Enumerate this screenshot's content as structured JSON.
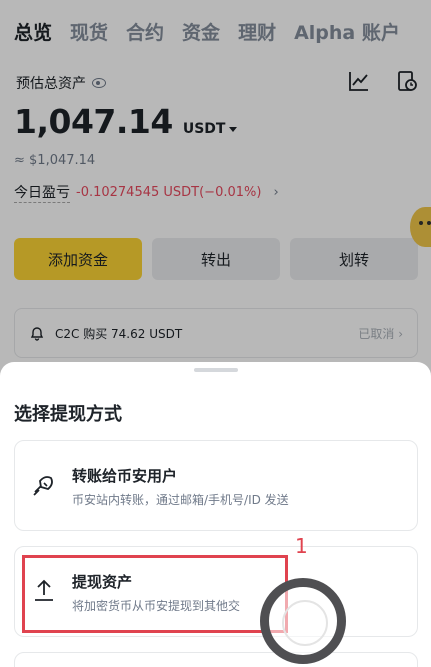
{
  "tabs": [
    "总览",
    "现货",
    "合约",
    "资金",
    "理财",
    "Alpha 账户"
  ],
  "summary": {
    "estimated_label": "预估总资产",
    "balance": "1,047.14",
    "currency": "USDT",
    "approx": "≈ $1,047.14",
    "pnl_label": "今日盈亏",
    "pnl_value": "-0.10274545 USDT(−0.01%)"
  },
  "actions": {
    "add_funds": "添加资金",
    "withdraw": "转出",
    "transfer": "划转"
  },
  "notice": {
    "text": "C2C 购买 74.62 USDT",
    "status": "已取消"
  },
  "sheet": {
    "title": "选择提现方式",
    "options": [
      {
        "title": "转账给币安用户",
        "subtitle": "币安站内转账，通过邮箱/手机号/ID 发送"
      },
      {
        "title": "提现资产",
        "subtitle": "将加密货币从币安提现到其他交"
      }
    ]
  },
  "annotation": {
    "marker": "1"
  },
  "colors": {
    "accent": "#fcd535",
    "negative": "#e84a5f",
    "highlight": "#e0434f"
  },
  "icons": [
    "eye-icon",
    "chart-icon",
    "history-icon",
    "bell-icon",
    "transfer-user-icon",
    "upload-icon"
  ]
}
